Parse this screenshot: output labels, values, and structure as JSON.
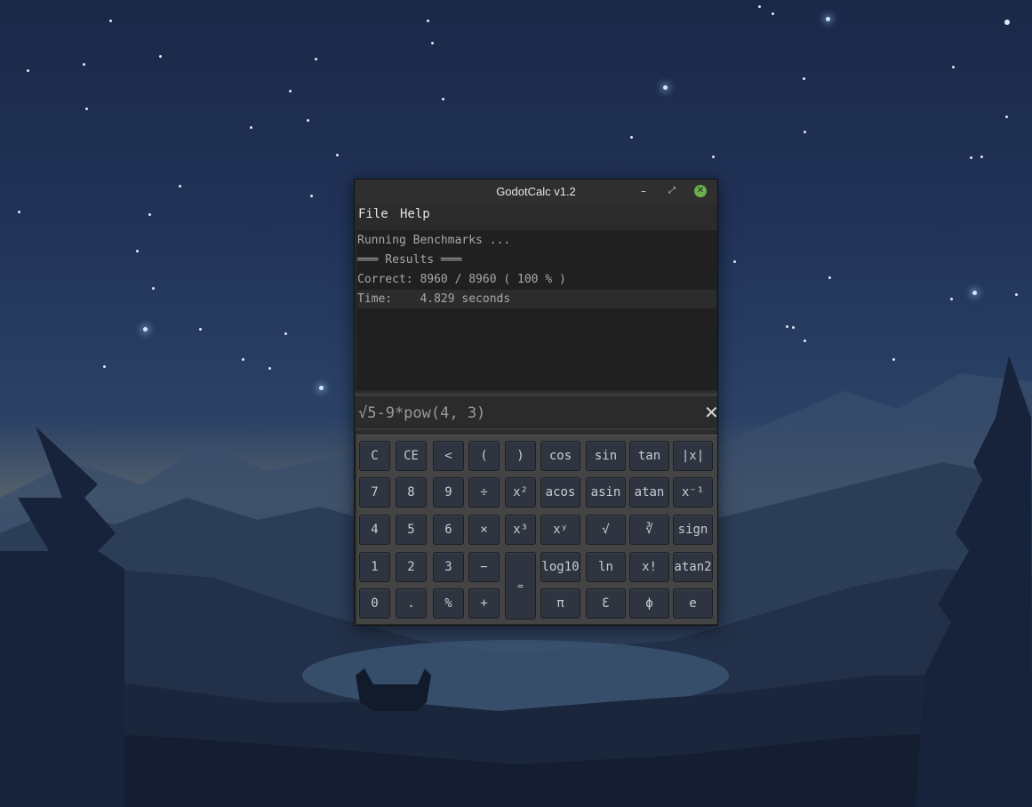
{
  "window": {
    "title": "GodotCalc v1.2",
    "minimize_glyph": "–",
    "maximize_glyph": "⤢",
    "close_glyph": "✕"
  },
  "menu": {
    "file": "File",
    "help": "Help"
  },
  "output": {
    "lines": [
      "Running Benchmarks ...",
      "═══ Results ═══",
      "Correct: 8960 / 8960 ( 100 % )",
      "Time:    4.829 seconds"
    ]
  },
  "expression": {
    "value": "√5-9*pow(4, 3)",
    "clear_glyph": "✕"
  },
  "keys": {
    "c": "C",
    "ce": "CE",
    "backspace": "<",
    "lparen": "(",
    "rparen": ")",
    "cos": "cos",
    "sin": "sin",
    "tan": "tan",
    "abs": "|x|",
    "n7": "7",
    "n8": "8",
    "n9": "9",
    "divide": "÷",
    "square": "x²",
    "acos": "acos",
    "asin": "asin",
    "atan": "atan",
    "inverse": "x⁻¹",
    "n4": "4",
    "n5": "5",
    "n6": "6",
    "multiply": "×",
    "cube": "x³",
    "power": "xʸ",
    "sqrt": "√",
    "cbrt": "∛",
    "sign": "sign",
    "n1": "1",
    "n2": "2",
    "n3": "3",
    "minus": "−",
    "equals": "=",
    "log10": "log10",
    "ln": "ln",
    "factorial": "x!",
    "atan2": "atan2",
    "n0": "0",
    "dot": ".",
    "percent": "%",
    "plus": "+",
    "pi": "π",
    "epsilon": "Ɛ",
    "phi": "ϕ",
    "e": "e"
  },
  "colors": {
    "window_bg": "#2b2b2b",
    "key_bg": "#2e3440",
    "close_button": "#6ab04c"
  }
}
